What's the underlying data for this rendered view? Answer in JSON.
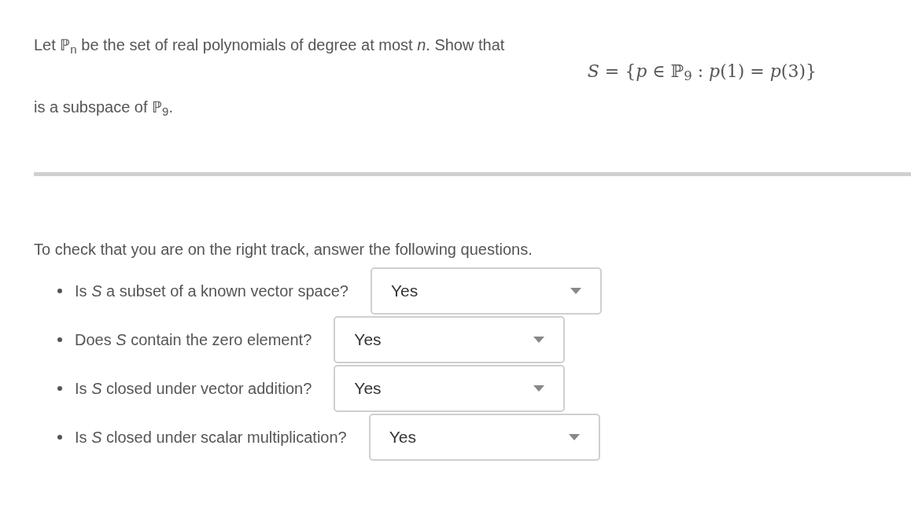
{
  "problem": {
    "intro": "Let ℙ$_{n}$ be the set of real polynomials of degree at most *n*.  Show that",
    "formula": "*S* = {*p* ∈ ℙ$_{9}$ : *p*(1) = *p*(3)}",
    "conclusion": "is a subspace of ℙ$_{9}$."
  },
  "check": {
    "prompt": "To check that you are on the right track, answer the following questions.",
    "questions": [
      {
        "text": "Is *S* a subset of a known vector space?",
        "answer": "Yes"
      },
      {
        "text": "Does *S* contain the zero element?",
        "answer": "Yes"
      },
      {
        "text": "Is *S* closed under vector addition?",
        "answer": "Yes"
      },
      {
        "text": "Is *S* closed under scalar multiplication?",
        "answer": "Yes"
      }
    ]
  }
}
